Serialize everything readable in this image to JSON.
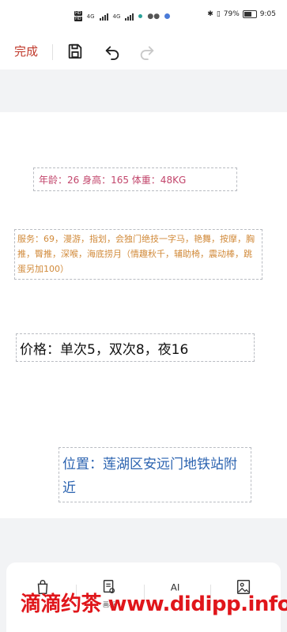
{
  "status_bar": {
    "sim1": "HD",
    "sim2": "HD",
    "net1": "4G",
    "net2": "4G",
    "battery": "79%",
    "battery_level": 0.79,
    "time": "9:05"
  },
  "toolbar": {
    "done_label": "完成",
    "icons": [
      "save-icon",
      "undo-icon",
      "redo-icon"
    ]
  },
  "content": {
    "line1": "年龄：26 身高：165 体重：48KG",
    "line2": "服务：69，漫游，指划，会独门绝技一字马，艳舞，按摩，胸推，臀推，深喉，海底捞月（情趣秋千，辅助椅，震动棒，跳蛋另加100）",
    "line3": "价格：单次5，双次8，夜16",
    "line4": "位置：莲湖区安远门地铁站附近"
  },
  "bottom_bar": {
    "items": [
      {
        "label": "",
        "icon": "bag-icon"
      },
      {
        "label": "画板",
        "icon": "sketch-icon"
      },
      {
        "label": "",
        "icon": "ai-icon"
      },
      {
        "label": "",
        "icon": "image-icon"
      }
    ]
  },
  "watermark": "滴滴约茶 www.didipp.info",
  "colors": {
    "accent_red": "#c0392b",
    "line1": "#c2456b",
    "line2": "#d18a3a",
    "line4": "#2b63b0",
    "watermark": "#e0161b"
  }
}
